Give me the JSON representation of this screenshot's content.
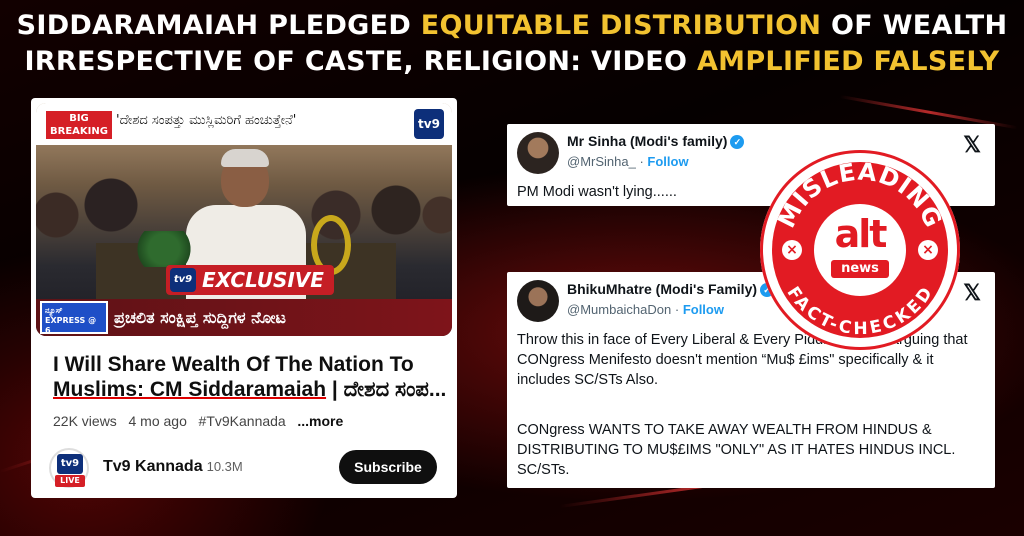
{
  "headline": {
    "line1_a": "SIDDARAMAIAH PLEDGED ",
    "line1_b": "EQUITABLE DISTRIBUTION",
    "line1_c": " OF WEALTH",
    "line2_a": "IRRESPECTIVE OF CASTE, RELIGION: VIDEO ",
    "line2_b": "AMPLIFIED FALSELY",
    "highlight_color": "#f2c230"
  },
  "youtube": {
    "thumbnail": {
      "breaking_badge": "BIG BREAKING",
      "ticker_text": "'ದೇಶದ ಸಂಪತ್ತು ಮುಸ್ಲಿಮರಿಗೆ ಹಂಚುತ್ತೇನೆ'",
      "channel_bug": "tv9",
      "exclusive_label": "EXCLUSIVE",
      "express_label": "ನ್ಯೂಸ್ EXPRESS @ 6",
      "lower_third": "ಪ್ರಚಲಿತ ಸಂಕ್ಷಿಪ್ತ ಸುದ್ದಿಗಳ ನೋಟ"
    },
    "title_line1": "I Will Share Wealth Of The Nation To",
    "title_line2_a": "Muslims: CM Siddaramaiah",
    "title_line2_b": " | ದೇಶದ ಸಂಪ...",
    "views": "22K views",
    "age": "4 mo ago",
    "hashtag": "#Tv9Kannada",
    "more": "...more",
    "channel_logo_text": "tv9",
    "live_badge": "LIVE",
    "channel_name": "Tv9 Kannada",
    "subscribers": "10.3M",
    "subscribe_label": "Subscribe"
  },
  "tweet1": {
    "name": "Mr Sinha (Modi's family)",
    "handle": "@MrSinha_",
    "follow": "Follow",
    "text": "PM Modi wasn't lying......"
  },
  "tweet2": {
    "name": "BhikuMhatre (Modi's Family)",
    "handle": "@MumbaichaDon",
    "follow": "Follow",
    "para1": "Throw this in face of Every Liberal & Every Piddi who was arguing that CONgress Menifesto doesn't mention “Mu$ £ims\" specifically & it includes SC/STs Also.",
    "para2": "CONgress WANTS TO TAKE AWAY WEALTH FROM HINDUS & DISTRIBUTING TO MU$£IMS \"ONLY\" AS IT HATES HINDUS INCL. SC/STs."
  },
  "stamp": {
    "top_text": "MISLEADING",
    "bottom_text": "FACT-CHECKED",
    "logo_alt": "alt",
    "logo_news": "news",
    "color": "#e21b23"
  }
}
